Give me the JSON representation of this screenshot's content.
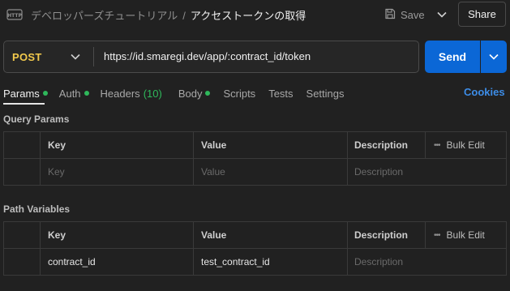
{
  "header": {
    "breadcrumb_parent": "デベロッパーズチュートリアル",
    "breadcrumb_separator": "/",
    "breadcrumb_current": "アクセストークンの取得",
    "save_label": "Save",
    "share_label": "Share"
  },
  "request": {
    "method": "POST",
    "url": "https://id.smaregi.dev/app/:contract_id/token",
    "send_label": "Send"
  },
  "tabs": [
    {
      "label": "Params",
      "active": true,
      "dot": true
    },
    {
      "label": "Auth",
      "dot": true
    },
    {
      "label": "Headers",
      "count": "(10)"
    },
    {
      "label": "Body",
      "dot": true
    },
    {
      "label": "Scripts"
    },
    {
      "label": "Tests"
    },
    {
      "label": "Settings"
    }
  ],
  "cookies_label": "Cookies",
  "query_params": {
    "title": "Query Params",
    "columns": {
      "key": "Key",
      "value": "Value",
      "description": "Description"
    },
    "bulk_edit": "Bulk Edit",
    "placeholder_row": {
      "key": "Key",
      "value": "Value",
      "description": "Description"
    }
  },
  "path_variables": {
    "title": "Path Variables",
    "columns": {
      "key": "Key",
      "value": "Value",
      "description": "Description"
    },
    "bulk_edit": "Bulk Edit",
    "rows": [
      {
        "key": "contract_id",
        "value": "test_contract_id",
        "description_placeholder": "Description"
      }
    ]
  },
  "colors": {
    "method": "#f2c94c",
    "send": "#0b67d6",
    "dot": "#2fb85b",
    "cookies": "#3d8de8"
  }
}
